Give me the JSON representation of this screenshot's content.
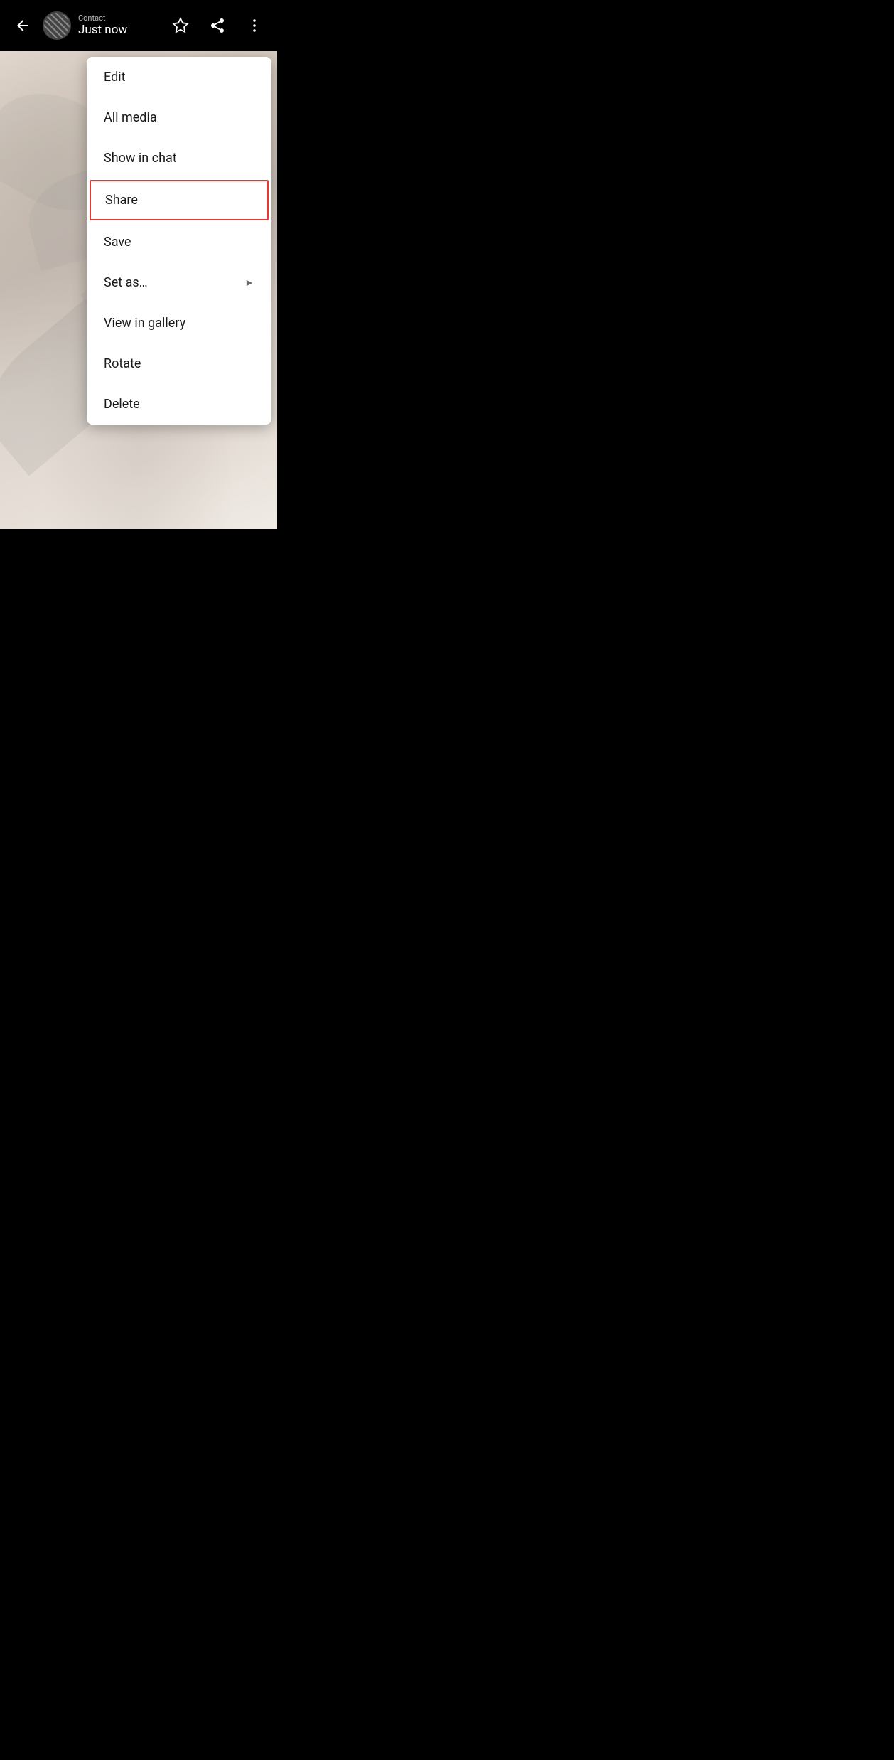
{
  "header": {
    "back_label": "←",
    "time_label": "Just now",
    "contact_name": "Contact"
  },
  "icons": {
    "back": "←",
    "star": "☆",
    "share": "↪",
    "more": "⋮",
    "chevron_right": "▶"
  },
  "menu": {
    "items": [
      {
        "id": "edit",
        "label": "Edit",
        "has_arrow": false,
        "highlighted": false
      },
      {
        "id": "all-media",
        "label": "All media",
        "has_arrow": false,
        "highlighted": false
      },
      {
        "id": "show-in-chat",
        "label": "Show in chat",
        "has_arrow": false,
        "highlighted": false
      },
      {
        "id": "share",
        "label": "Share",
        "has_arrow": false,
        "highlighted": true
      },
      {
        "id": "save",
        "label": "Save",
        "has_arrow": false,
        "highlighted": false
      },
      {
        "id": "set-as",
        "label": "Set as…",
        "has_arrow": true,
        "highlighted": false
      },
      {
        "id": "view-in-gallery",
        "label": "View in gallery",
        "has_arrow": false,
        "highlighted": false
      },
      {
        "id": "rotate",
        "label": "Rotate",
        "has_arrow": false,
        "highlighted": false
      },
      {
        "id": "delete",
        "label": "Delete",
        "has_arrow": false,
        "highlighted": false
      }
    ]
  },
  "colors": {
    "highlight_border": "#e53935",
    "background": "#000000",
    "menu_bg": "#ffffff",
    "text_primary": "#1a1a1a",
    "text_white": "#ffffff"
  }
}
